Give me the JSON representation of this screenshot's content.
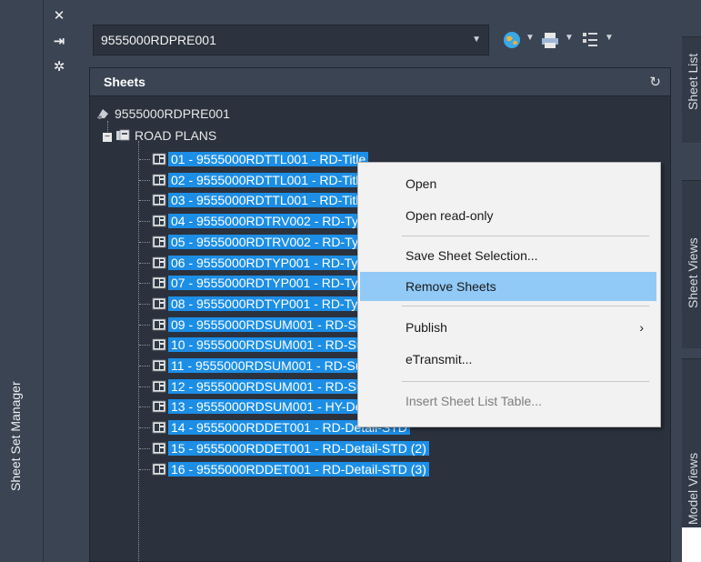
{
  "left_panel": {
    "title": "Sheet Set Manager"
  },
  "controls": {
    "close": "✕",
    "autohide": "⇥",
    "properties": "✲"
  },
  "toolbar": {
    "sheet_set": "9555000RDPRE001"
  },
  "panel": {
    "title": "Sheets"
  },
  "right_tabs": [
    "Sheet List",
    "Sheet Views",
    "Model Views"
  ],
  "tree": {
    "root": "9555000RDPRE001",
    "subset": "ROAD PLANS",
    "sheets": [
      "01 - 9555000RDTTL001 - RD-Title",
      "02 - 9555000RDTTL001 - RD-Title (2)",
      "03 - 9555000RDTTL001 - RD-Title (3)",
      "04 - 9555000RDTRV002 - RD-Typical",
      "05 - 9555000RDTRV002 - RD-Typical (2)",
      "06 - 9555000RDTYP001 - RD-Typical",
      "07 - 9555000RDTYP001 - RD-Typical (2)",
      "08 - 9555000RDTYP001 - RD-Typical (3)",
      "09 - 9555000RDSUM001 - RD-Summary",
      "10 - 9555000RDSUM001 - RD-Summary (2)",
      "11 - 9555000RDSUM001 - RD-Summary (3)",
      "12 - 9555000RDSUM001 - RD-Summary (4)",
      "13 - 9555000RDSUM001 - HY-Detail-HDS",
      "14 - 9555000RDDET001 - RD-Detail-STD",
      "15 - 9555000RDDET001 - RD-Detail-STD (2)",
      "16 - 9555000RDDET001 - RD-Detail-STD (3)"
    ]
  },
  "context_menu": {
    "items": [
      {
        "label": "Open"
      },
      {
        "label": "Open read-only"
      },
      {
        "label": "Save Sheet Selection..."
      },
      {
        "label": "Remove Sheets"
      },
      {
        "label": "Publish",
        "submenu": "›"
      },
      {
        "label": "eTransmit..."
      },
      {
        "label": "Insert Sheet List Table..."
      }
    ]
  },
  "colors": {
    "selection": "#1c8ee6",
    "menu_highlight": "#91c9f7",
    "panel_bg": "#2b323d"
  }
}
